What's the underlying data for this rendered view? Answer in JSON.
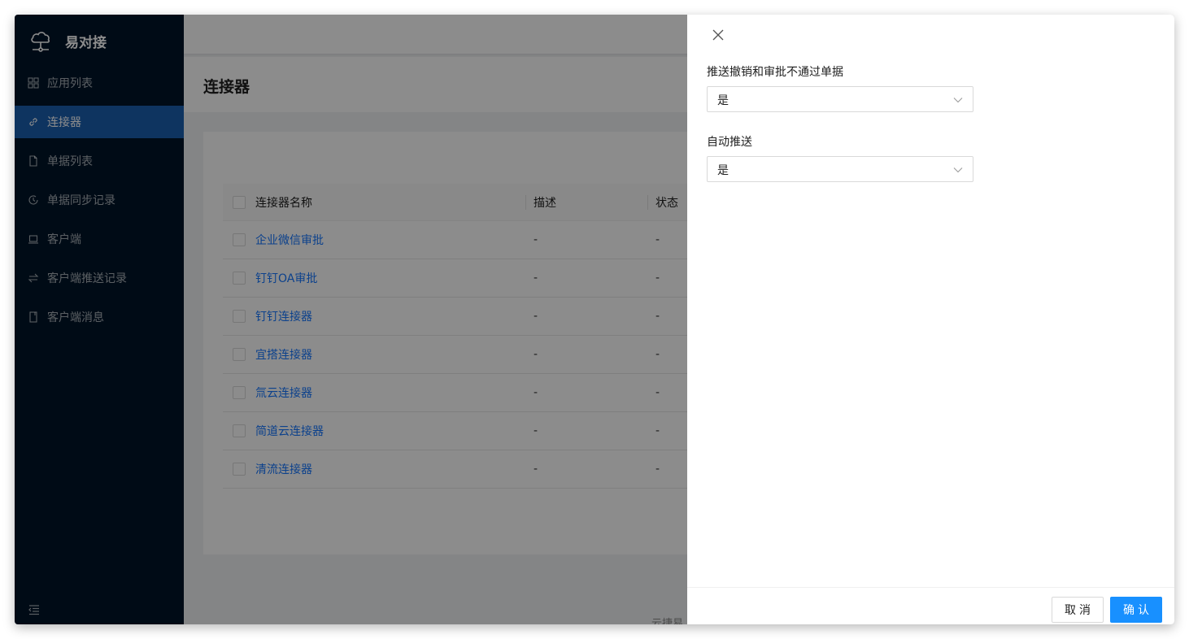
{
  "app": {
    "name": "易对接"
  },
  "sidebar": {
    "items": [
      {
        "label": "应用列表",
        "icon": "grid-icon",
        "active": false
      },
      {
        "label": "连接器",
        "icon": "link-icon",
        "active": true
      },
      {
        "label": "单据列表",
        "icon": "file-icon",
        "active": false
      },
      {
        "label": "单据同步记录",
        "icon": "history-icon",
        "active": false
      },
      {
        "label": "客户端",
        "icon": "laptop-icon",
        "active": false
      },
      {
        "label": "客户端推送记录",
        "icon": "swap-icon",
        "active": false
      },
      {
        "label": "客户端消息",
        "icon": "book-icon",
        "active": false
      }
    ]
  },
  "page": {
    "title": "连接器"
  },
  "table": {
    "columns": [
      "连接器名称",
      "描述",
      "状态"
    ],
    "rows": [
      {
        "name": "企业微信审批",
        "desc": "-",
        "status": "-"
      },
      {
        "name": "钉钉OA审批",
        "desc": "-",
        "status": "-"
      },
      {
        "name": "钉钉连接器",
        "desc": "-",
        "status": "-"
      },
      {
        "name": "宜搭连接器",
        "desc": "-",
        "status": "-"
      },
      {
        "name": "氚云连接器",
        "desc": "-",
        "status": "-"
      },
      {
        "name": "简道云连接器",
        "desc": "-",
        "status": "-"
      },
      {
        "name": "清流连接器",
        "desc": "-",
        "status": "-"
      }
    ]
  },
  "footer": {
    "text": "云捷易"
  },
  "drawer": {
    "fields": [
      {
        "label": "推送撤销和审批不通过单据",
        "value": "是"
      },
      {
        "label": "自动推送",
        "value": "是"
      }
    ],
    "cancel_label": "取消",
    "ok_label": "确认"
  },
  "colors": {
    "sidebar_bg": "#001529",
    "active_item": "#1a5fb0",
    "primary": "#1890ff",
    "link": "#1677ff"
  }
}
